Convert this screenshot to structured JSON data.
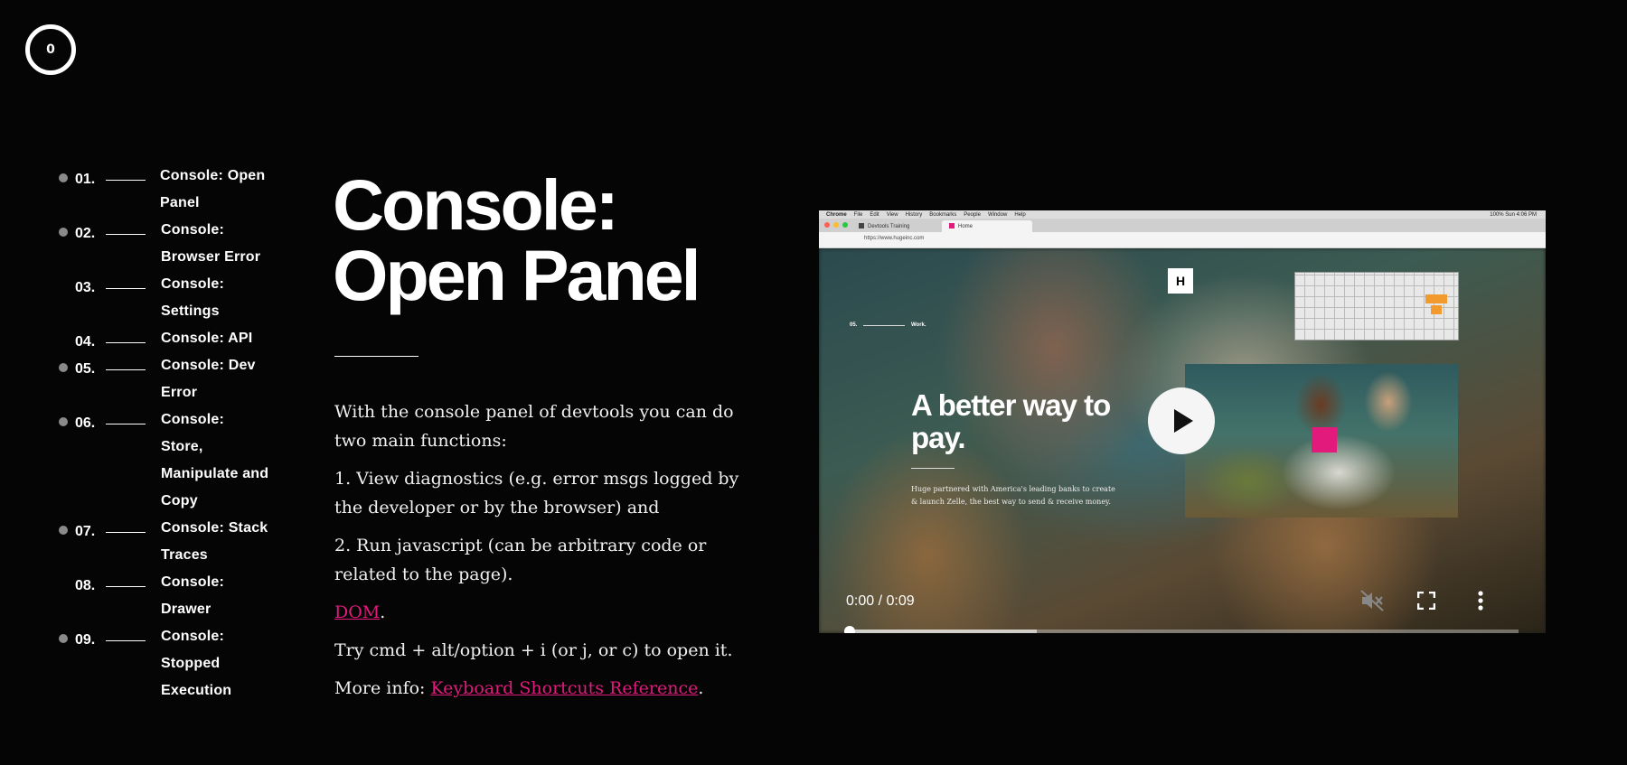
{
  "logo": {
    "text": "0"
  },
  "nav": [
    {
      "num": "01.",
      "label": "Console: Open Panel",
      "dot": true
    },
    {
      "num": "02.",
      "label": "Console: Browser Error",
      "dot": true
    },
    {
      "num": "03.",
      "label": "Console: Settings",
      "dot": false
    },
    {
      "num": "04.",
      "label": "Console: API",
      "dot": false
    },
    {
      "num": "05.",
      "label": "Console: Dev Error",
      "dot": true
    },
    {
      "num": "06.",
      "label": "Console: Store, Manipulate and Copy",
      "dot": true
    },
    {
      "num": "07.",
      "label": "Console: Stack Traces",
      "dot": true
    },
    {
      "num": "08.",
      "label": "Console: Drawer",
      "dot": false
    },
    {
      "num": "09.",
      "label": "Console: Stopped Execution",
      "dot": true
    }
  ],
  "article": {
    "title_line1": "Console:",
    "title_line2": "Open Panel",
    "p1": "With the console panel of devtools you can do two main functions:",
    "p2": "1. View diagnostics (e.g. error msgs logged by the developer or by the browser) and",
    "p3": "2. Run javascript (can be arbitrary code or related to the page).",
    "dom_link": "DOM",
    "p5": "Try cmd + alt/option + i (or j, or c) to open it.",
    "more_prefix": "More info: ",
    "more_link": "Keyboard Shortcuts Reference",
    "period": "."
  },
  "video": {
    "menubar": [
      "Chrome",
      "File",
      "Edit",
      "View",
      "History",
      "Bookmarks",
      "People",
      "Window",
      "Help"
    ],
    "menubar_right": "100%  Sun 4:06 PM",
    "tab1": "Devtools Training",
    "tab2": "Home",
    "url": "https://www.hugeinc.com",
    "badge": "H",
    "inner_num": "05.",
    "inner_work": "Work.",
    "inner_headline": "A better way to pay.",
    "inner_copy": "Huge partnered with America's leading banks to create & launch Zelle, the best way to send & receive money.",
    "time": "0:00 / 0:09",
    "progress_buffered": 0.28,
    "progress_played": 0
  },
  "colors": {
    "accent": "#e11a7b",
    "background": "#050505"
  }
}
